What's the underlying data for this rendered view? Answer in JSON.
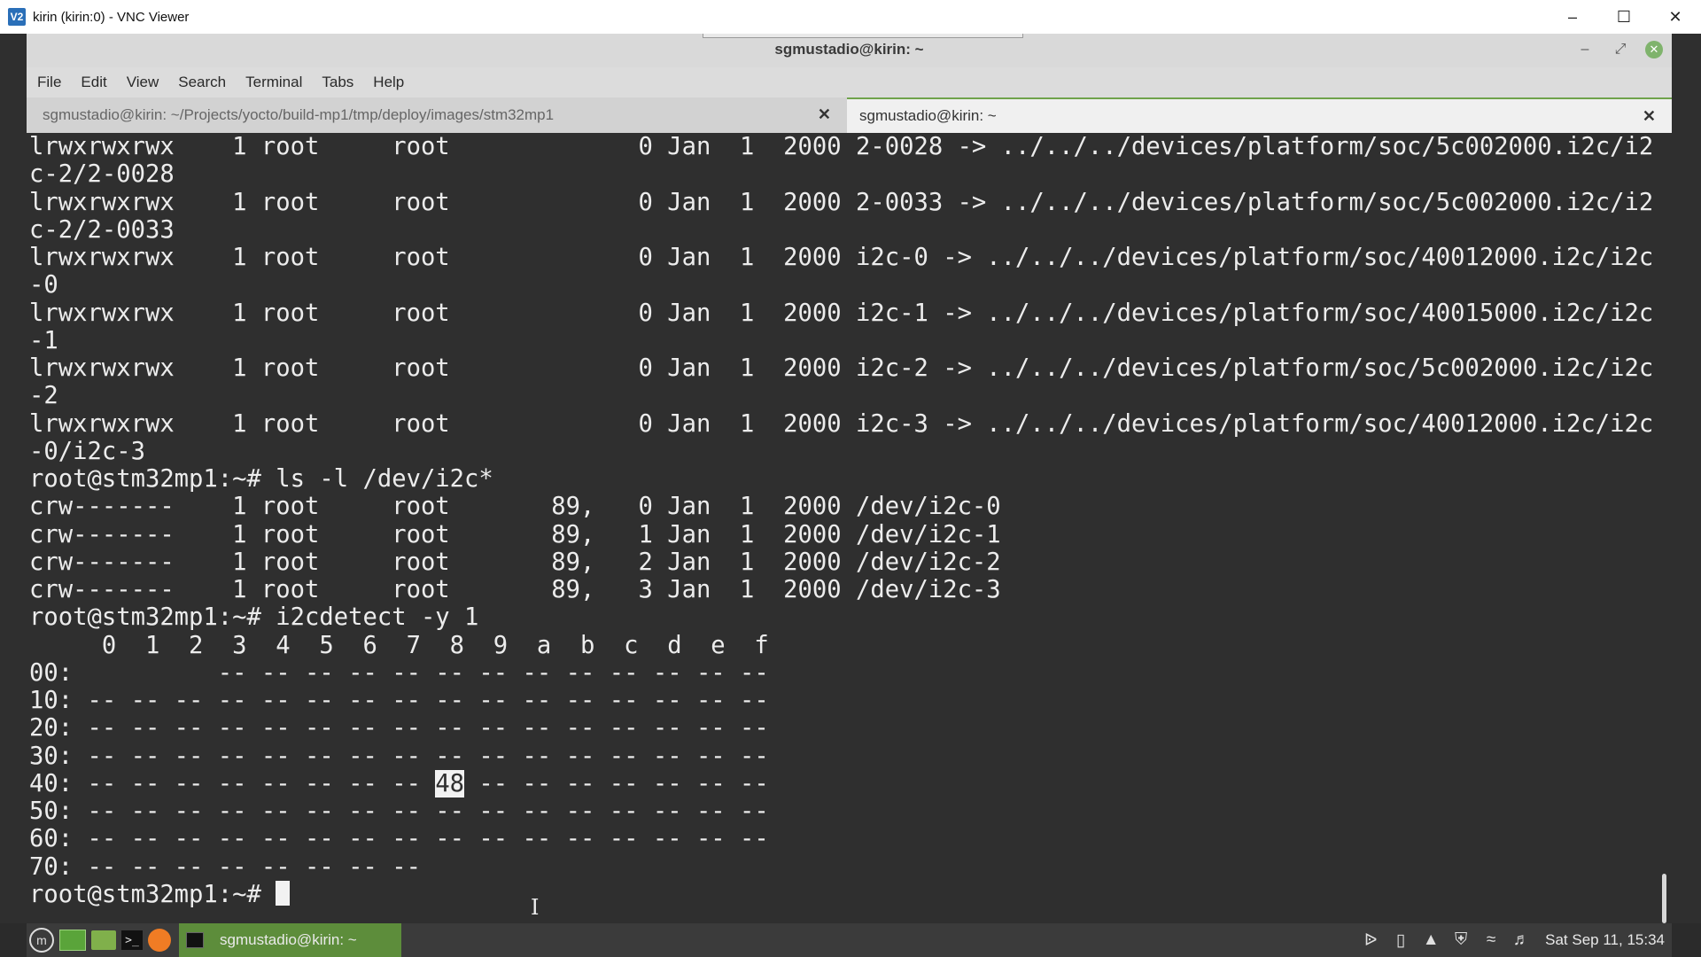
{
  "host_window": {
    "logo": "V2",
    "title": "kirin (kirin:0) - VNC Viewer",
    "controls": [
      "minimize",
      "maximize",
      "close"
    ]
  },
  "terminal": {
    "title": "sgmustadio@kirin: ~",
    "menu": [
      "File",
      "Edit",
      "View",
      "Search",
      "Terminal",
      "Tabs",
      "Help"
    ],
    "tabs": [
      {
        "label": "sgmustadio@kirin: ~/Projects/yocto/build-mp1/tmp/deploy/images/stm32mp1",
        "active": false
      },
      {
        "label": "sgmustadio@kirin: ~",
        "active": true
      }
    ],
    "lines": [
      "lrwxrwxrwx    1 root     root             0 Jan  1  2000 2-0028 -> ../../../devices/platform/soc/5c002000.i2c/i2",
      "c-2/2-0028",
      "lrwxrwxrwx    1 root     root             0 Jan  1  2000 2-0033 -> ../../../devices/platform/soc/5c002000.i2c/i2",
      "c-2/2-0033",
      "lrwxrwxrwx    1 root     root             0 Jan  1  2000 i2c-0 -> ../../../devices/platform/soc/40012000.i2c/i2c",
      "-0",
      "lrwxrwxrwx    1 root     root             0 Jan  1  2000 i2c-1 -> ../../../devices/platform/soc/40015000.i2c/i2c",
      "-1",
      "lrwxrwxrwx    1 root     root             0 Jan  1  2000 i2c-2 -> ../../../devices/platform/soc/5c002000.i2c/i2c",
      "-2",
      "lrwxrwxrwx    1 root     root             0 Jan  1  2000 i2c-3 -> ../../../devices/platform/soc/40012000.i2c/i2c",
      "-0/i2c-3",
      "root@stm32mp1:~# ls -l /dev/i2c*",
      "crw-------    1 root     root       89,   0 Jan  1  2000 /dev/i2c-0",
      "crw-------    1 root     root       89,   1 Jan  1  2000 /dev/i2c-1",
      "crw-------    1 root     root       89,   2 Jan  1  2000 /dev/i2c-2",
      "crw-------    1 root     root       89,   3 Jan  1  2000 /dev/i2c-3",
      "root@stm32mp1:~# i2cdetect -y 1",
      "     0  1  2  3  4  5  6  7  8  9  a  b  c  d  e  f",
      "00:          -- -- -- -- -- -- -- -- -- -- -- -- --",
      "10: -- -- -- -- -- -- -- -- -- -- -- -- -- -- -- --",
      "20: -- -- -- -- -- -- -- -- -- -- -- -- -- -- -- --",
      "30: -- -- -- -- -- -- -- -- -- -- -- -- -- -- -- --"
    ],
    "row40": {
      "before": "40: -- -- -- -- -- -- -- -- ",
      "highlight": "48",
      "after": " -- -- -- -- -- -- --"
    },
    "lines_after": [
      "50: -- -- -- -- -- -- -- -- -- -- -- -- -- -- -- --",
      "60: -- -- -- -- -- -- -- -- -- -- -- -- -- -- -- --",
      "70: -- -- -- -- -- -- -- --"
    ],
    "prompt": "root@stm32mp1:~# "
  },
  "taskbar": {
    "launchers": [
      "menu-icon",
      "show-desktop-icon",
      "files-icon",
      "terminal-icon",
      "firefox-icon"
    ],
    "task_label": "sgmustadio@kirin: ~",
    "tray": [
      "bluetooth-icon",
      "clipboard-icon",
      "update-icon",
      "shield-icon",
      "wifi-icon",
      "volume-icon"
    ],
    "clock": "Sat Sep 11, 15:34"
  }
}
